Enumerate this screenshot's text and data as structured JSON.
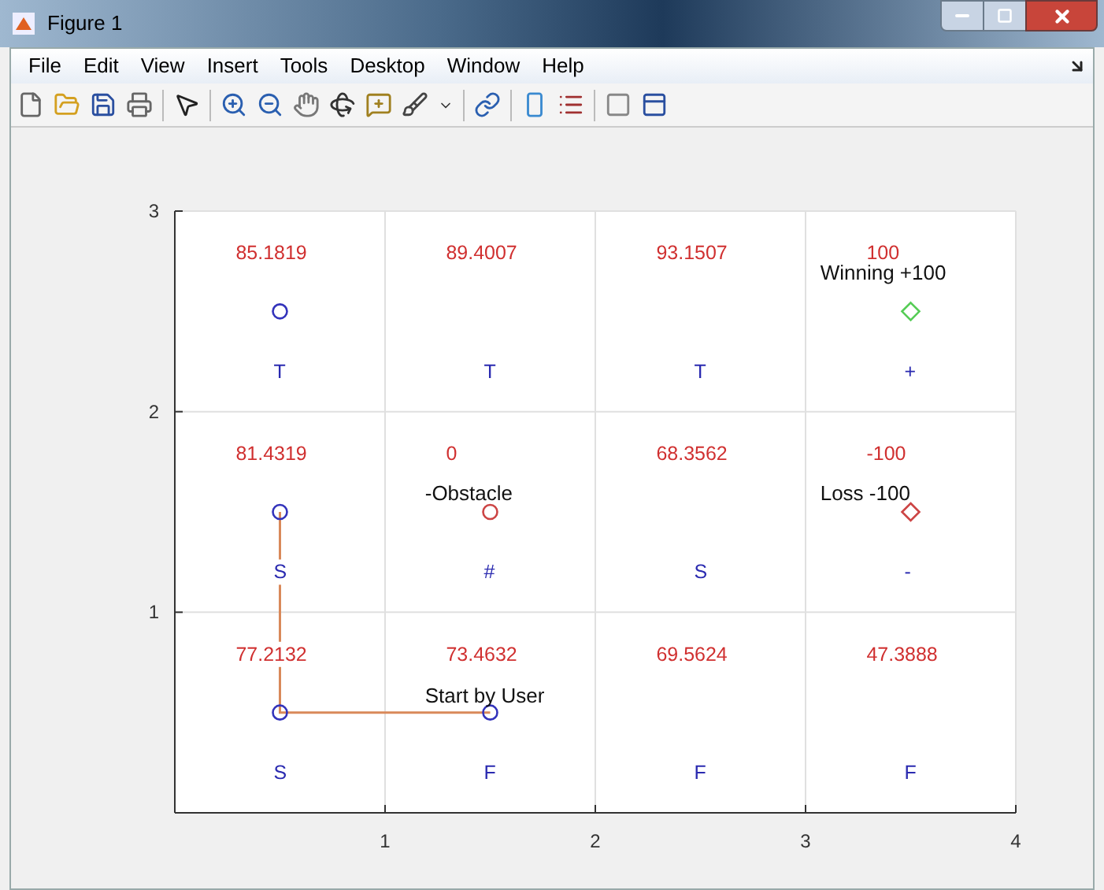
{
  "window": {
    "title": "Figure 1"
  },
  "menu": [
    "File",
    "Edit",
    "View",
    "Insert",
    "Tools",
    "Desktop",
    "Window",
    "Help"
  ],
  "plot": {
    "xticks": [
      "1",
      "2",
      "3",
      "4"
    ],
    "yticks": [
      "3",
      "2",
      "1"
    ],
    "cells": [
      [
        {
          "value": "85.1819",
          "policy": "T"
        },
        {
          "value": "89.4007",
          "policy": "T"
        },
        {
          "value": "93.1507",
          "policy": "T"
        },
        {
          "value": "100",
          "policy": "+",
          "note": "Winning +100"
        }
      ],
      [
        {
          "value": "81.4319",
          "policy": "S"
        },
        {
          "value": "0",
          "policy": "#",
          "note": "-Obstacle"
        },
        {
          "value": "68.3562",
          "policy": "S"
        },
        {
          "value": "-100",
          "policy": "-",
          "note": "Loss -100"
        }
      ],
      [
        {
          "value": "77.2132",
          "policy": "S"
        },
        {
          "value": "73.4632",
          "policy": "F",
          "note": "Start by User"
        },
        {
          "value": "69.5624",
          "policy": "F"
        },
        {
          "value": "47.3888",
          "policy": "F"
        }
      ]
    ]
  }
}
